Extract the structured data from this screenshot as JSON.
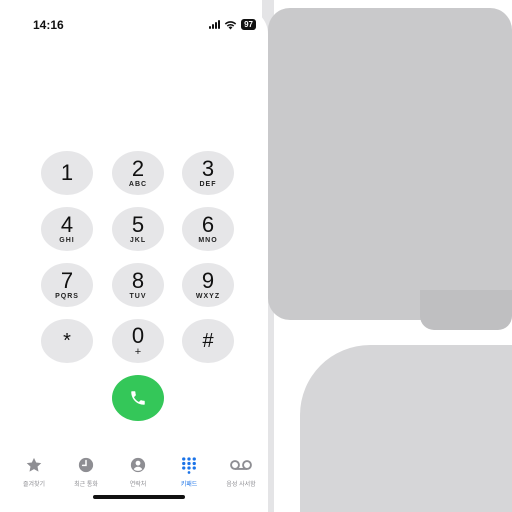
{
  "status_bar": {
    "time": "14:16",
    "battery": "97"
  },
  "keypad": {
    "keys": [
      {
        "digit": "1",
        "letters": ""
      },
      {
        "digit": "2",
        "letters": "ABC"
      },
      {
        "digit": "3",
        "letters": "DEF"
      },
      {
        "digit": "4",
        "letters": "GHI"
      },
      {
        "digit": "5",
        "letters": "JKL"
      },
      {
        "digit": "6",
        "letters": "MNO"
      },
      {
        "digit": "7",
        "letters": "PQRS"
      },
      {
        "digit": "8",
        "letters": "TUV"
      },
      {
        "digit": "9",
        "letters": "WXYZ"
      },
      {
        "digit": "*",
        "letters": ""
      },
      {
        "digit": "0",
        "letters": "+"
      },
      {
        "digit": "#",
        "letters": ""
      }
    ]
  },
  "call_button": {
    "icon": "phone-icon",
    "color": "#34c759"
  },
  "tab_bar": {
    "active_color": "#1a73e8",
    "tabs": [
      {
        "label": "즐겨찾기",
        "icon": "star-icon"
      },
      {
        "label": "최근 통화",
        "icon": "clock-icon"
      },
      {
        "label": "연락처",
        "icon": "contact-icon"
      },
      {
        "label": "키패드",
        "icon": "keypad-icon"
      },
      {
        "label": "음성 사서함",
        "icon": "voicemail-icon"
      }
    ]
  }
}
